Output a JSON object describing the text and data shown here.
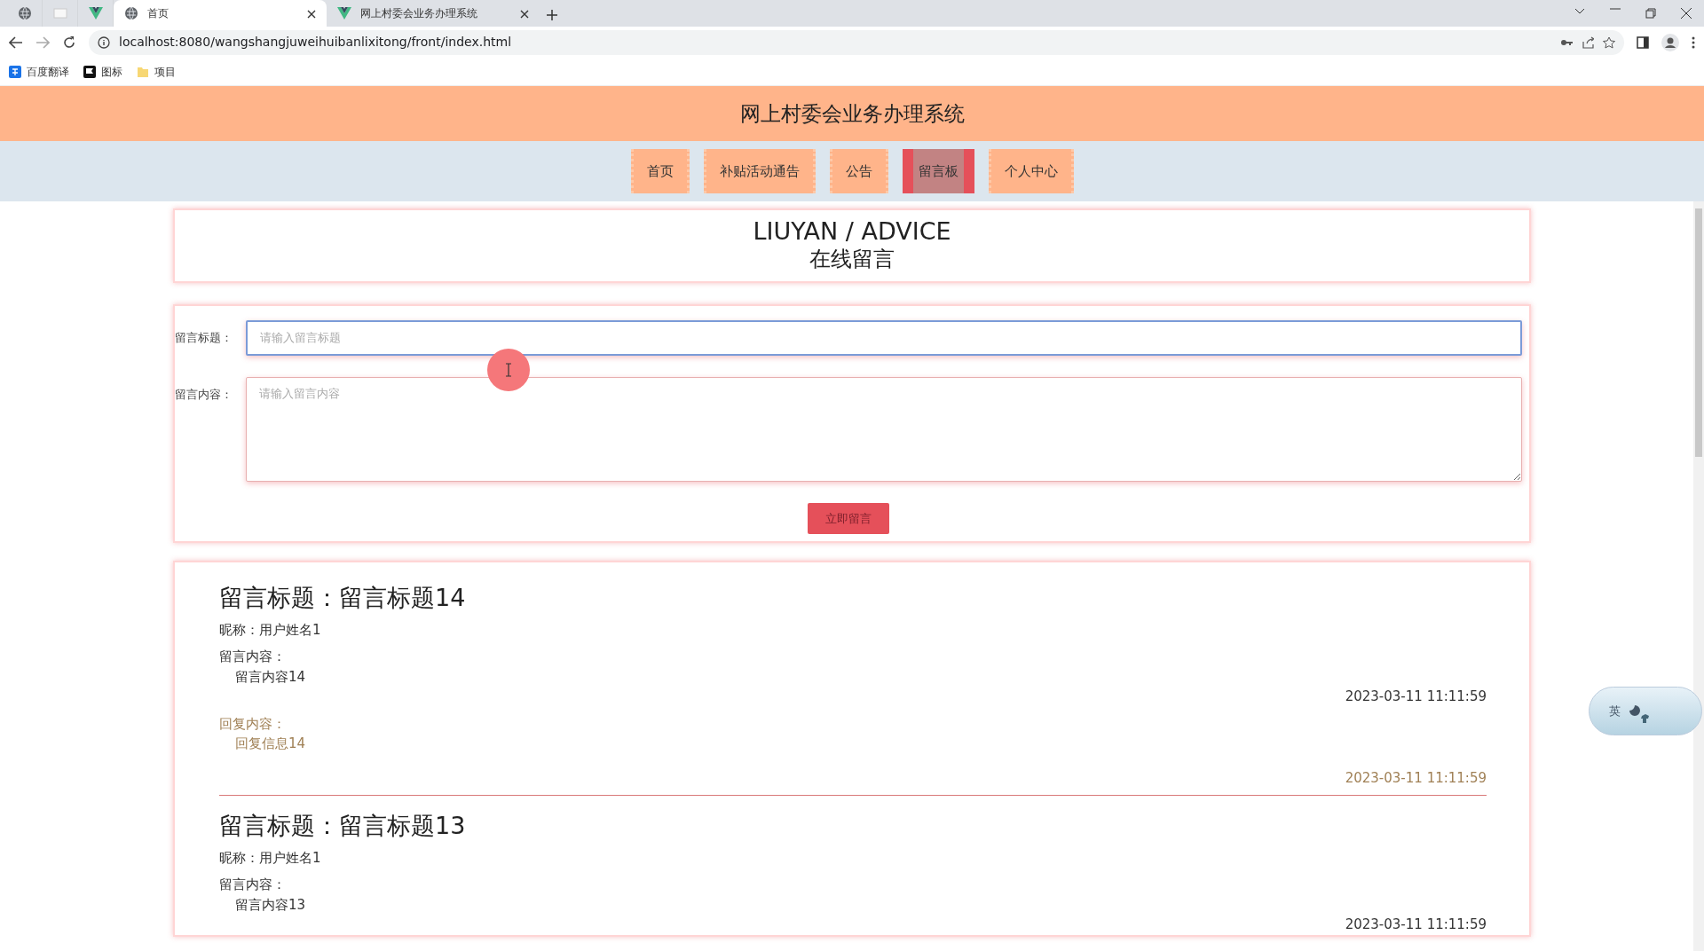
{
  "browser": {
    "tabs": [
      {
        "kind": "pinned",
        "selected": false
      },
      {
        "kind": "pinned",
        "selected": false
      },
      {
        "kind": "pinned",
        "selected": false
      },
      {
        "kind": "page",
        "title": "首页",
        "selected": true
      },
      {
        "kind": "page",
        "title": "网上村委会业务办理系统",
        "selected": false
      }
    ],
    "address": "localhost:8080/wangshangjuweihuibanlixitong/front/index.html",
    "bookmarks": [
      {
        "label": "百度翻译"
      },
      {
        "label": "图标"
      },
      {
        "label": "项目"
      }
    ]
  },
  "site_title": "网上村委会业务办理系统",
  "nav": [
    {
      "label": "首页",
      "selected": false
    },
    {
      "label": "补贴活动通告",
      "selected": false
    },
    {
      "label": "公告",
      "selected": false
    },
    {
      "label": "留言板",
      "selected": true
    },
    {
      "label": "个人中心",
      "selected": false
    }
  ],
  "banner": {
    "title": "LIUYAN / ADVICE",
    "subtitle": "在线留言"
  },
  "form": {
    "fields": [
      {
        "kind": "input",
        "label": "留言标题：",
        "placeholder": "请输入留言标题",
        "focused": true
      },
      {
        "kind": "textarea",
        "label": "留言内容：",
        "placeholder": "请输入留言内容",
        "focused": false
      }
    ],
    "submit": "立即留言"
  },
  "messages": [
    {
      "title": "留言标题：留言标题14",
      "nickname": "昵称：用户姓名1",
      "content_label": "留言内容：",
      "content": "留言内容14",
      "time": "2023-03-11 11:11:59",
      "reply_label": "回复内容：",
      "reply": "回复信息14",
      "reply_time": "2023-03-11 11:11:59"
    },
    {
      "title": "留言标题：留言标题13",
      "nickname": "昵称：用户姓名1",
      "content_label": "留言内容：",
      "content": "留言内容13",
      "time": "2023-03-11 11:11:59"
    }
  ],
  "ime": {
    "label": "英"
  }
}
